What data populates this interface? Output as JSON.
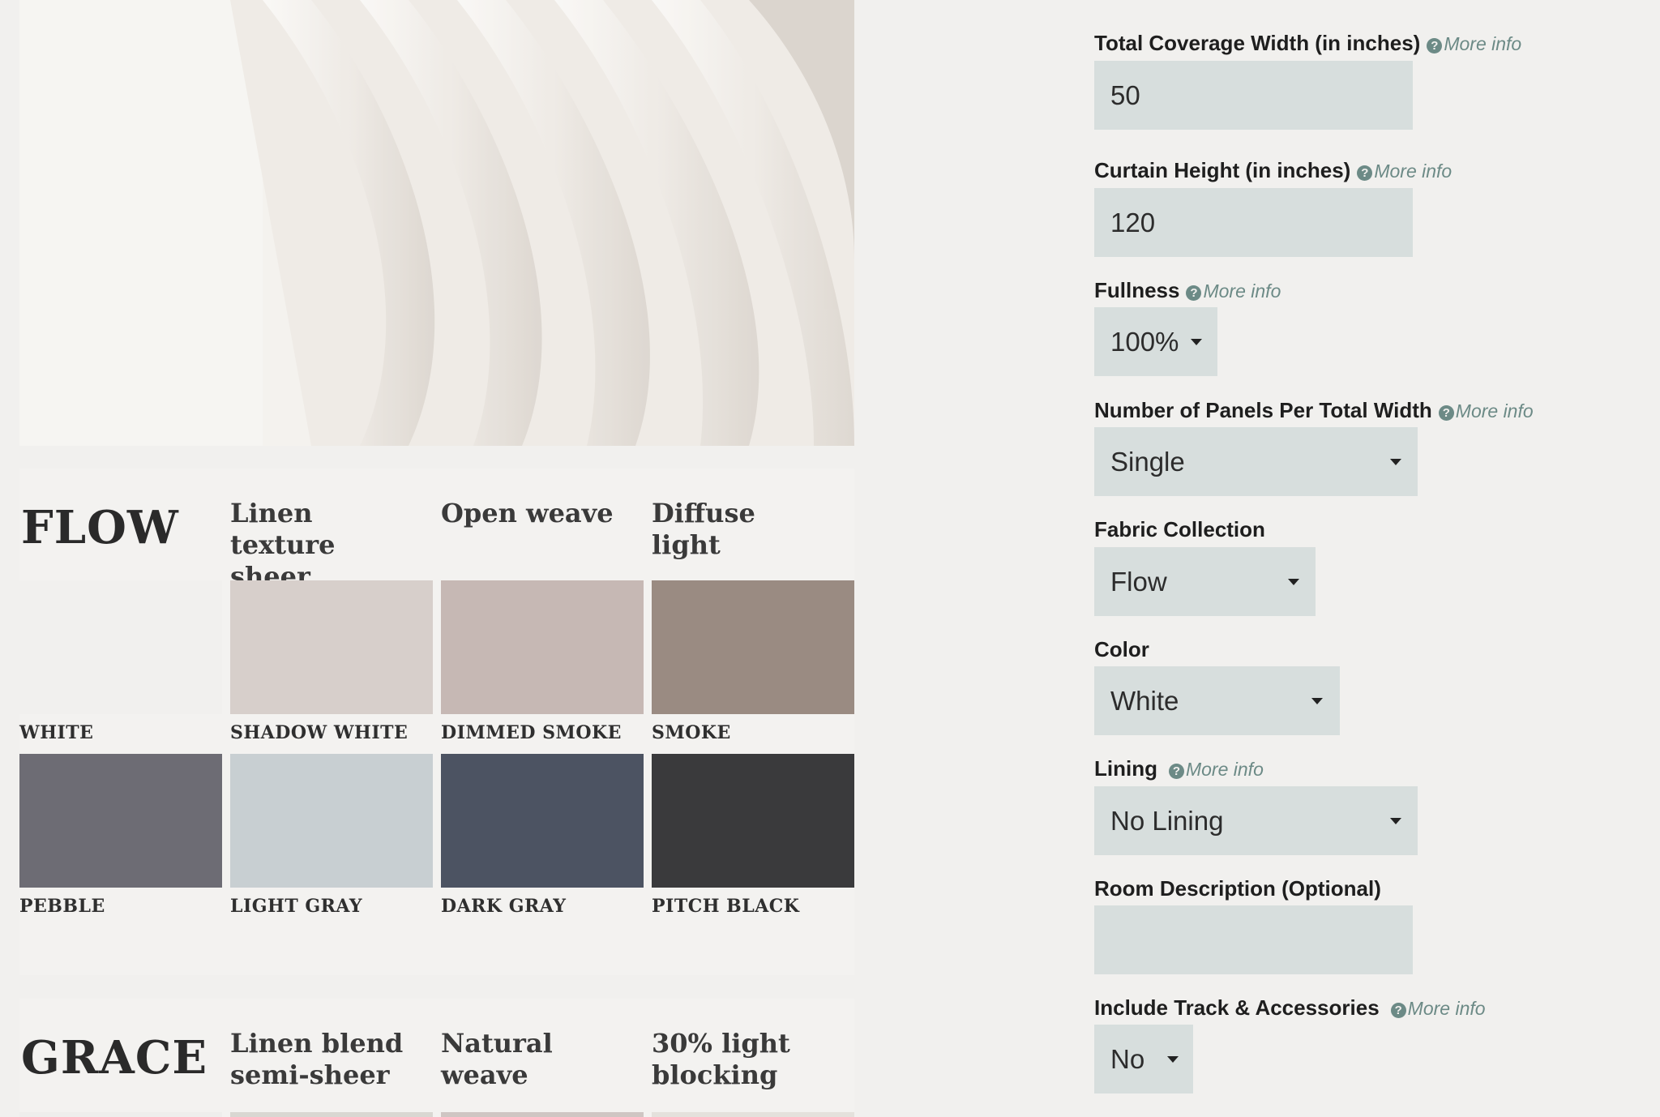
{
  "colors": {
    "page_bg": "#f1f0ee",
    "input_bg": "#d7dedd",
    "link": "#6c8a86"
  },
  "collections": [
    {
      "name": "FLOW",
      "attributes": [
        "Linen texture sheer",
        "Open weave",
        "Diffuse light"
      ],
      "swatches": [
        {
          "label": "WHITE",
          "color": "#f1f0ee"
        },
        {
          "label": "SHADOW WHITE",
          "color": "#d7cfcb"
        },
        {
          "label": "DIMMED SMOKE",
          "color": "#c6b8b4"
        },
        {
          "label": "SMOKE",
          "color": "#9a8b82"
        },
        {
          "label": "PEBBLE",
          "color": "#6d6c74"
        },
        {
          "label": "LIGHT GRAY",
          "color": "#c8cfd2"
        },
        {
          "label": "DARK GRAY",
          "color": "#4c5362"
        },
        {
          "label": "PITCH BLACK",
          "color": "#3a3a3c"
        }
      ]
    },
    {
      "name": "GRACE",
      "attributes": [
        "Linen blend semi-sheer",
        "Natural weave",
        "30% light blocking"
      ],
      "swatch_colors": [
        "#eeeeec",
        "#d9d7d2",
        "#cfc6c3",
        "#e4e1dc"
      ]
    }
  ],
  "form": {
    "more_info": "More info",
    "fields": [
      {
        "label": "Total Coverage Width (in inches)",
        "value": "50",
        "more_info": true
      },
      {
        "label": "Curtain Height (in inches)",
        "value": "120",
        "more_info": true
      },
      {
        "label": "Fullness",
        "value": "100%",
        "more_info": true
      },
      {
        "label": "Number of Panels Per Total Width",
        "value": "Single",
        "more_info": true
      },
      {
        "label": "Fabric Collection",
        "value": "Flow",
        "more_info": false
      },
      {
        "label": "Color",
        "value": "White",
        "more_info": false
      },
      {
        "label": "Lining",
        "value": "No Lining",
        "more_info": true
      },
      {
        "label": "Room Description (Optional)",
        "value": "",
        "more_info": false
      },
      {
        "label": "Include Track & Accessories",
        "value": "No",
        "more_info": true
      }
    ]
  }
}
